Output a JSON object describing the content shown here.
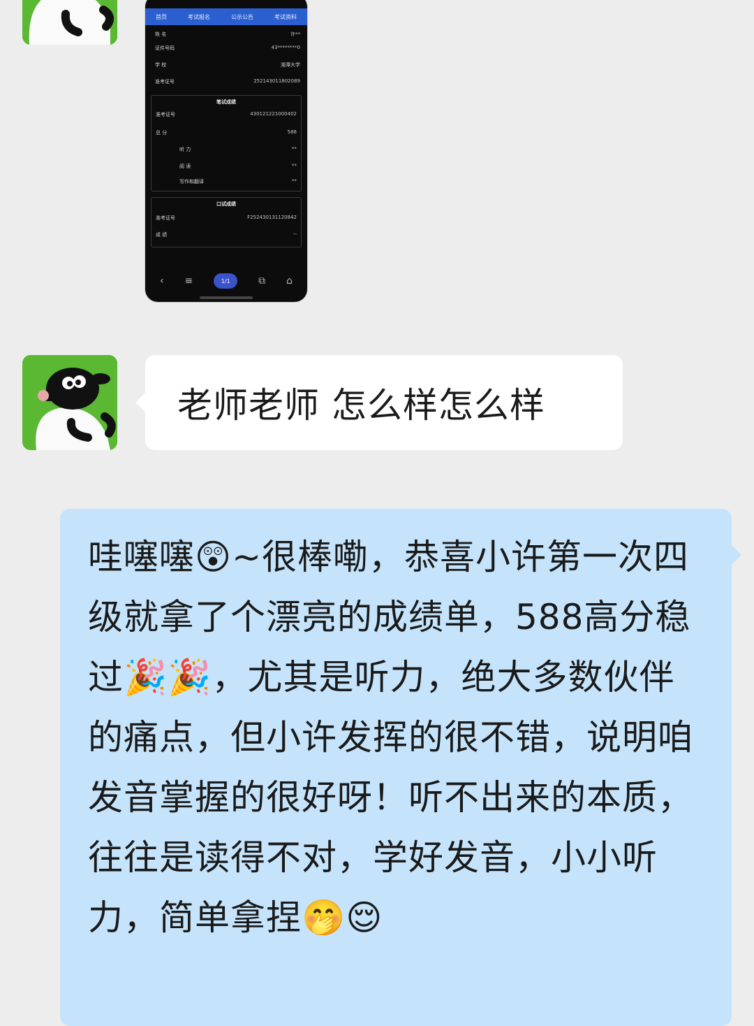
{
  "chat": {
    "image_message": {
      "nav_tabs": [
        "首页",
        "考试报名",
        "公示公告",
        "考试资料"
      ],
      "rows_top": [
        {
          "label": "姓 名",
          "value": "许**"
        },
        {
          "label": "证件号码",
          "value": "43********0"
        },
        {
          "label": "学 校",
          "value": "湘潭大学"
        },
        {
          "label": "准考证号",
          "value": "252143011802089"
        }
      ],
      "written_section": {
        "title": "笔试成绩",
        "rows": [
          {
            "label": "准考证号",
            "value": "430121221000402"
          },
          {
            "label": "总 分",
            "value": "588"
          },
          {
            "label": "听 力",
            "value": "**"
          },
          {
            "label": "阅 读",
            "value": "**"
          },
          {
            "label": "写作和翻译",
            "value": "**"
          }
        ]
      },
      "oral_section": {
        "title": "口试成绩",
        "rows": [
          {
            "label": "准考证号",
            "value": "F252430131120842"
          },
          {
            "label": "成 绩",
            "value": "--"
          }
        ]
      },
      "bottom_bar_center": "1/1"
    },
    "student_message": "老师老师 怎么样怎么样",
    "teacher_message": "哇噻噻😲~很棒嘞，恭喜小许第一次四级就拿了个漂亮的成绩单，588高分稳过🎉🎉，尤其是听力，绝大多数伙伴的痛点，但小许发挥的很不错，说明咱发音掌握的很好呀！听不出来的本质，往往是读得不对，学好发音，小小听力，简单拿捏🤭😌"
  },
  "colors": {
    "background": "#ededed",
    "incoming_bubble": "#ffffff",
    "outgoing_bubble": "#c5e4fb",
    "avatar_green": "#5bb832",
    "nav_blue": "#2b5fd0"
  }
}
